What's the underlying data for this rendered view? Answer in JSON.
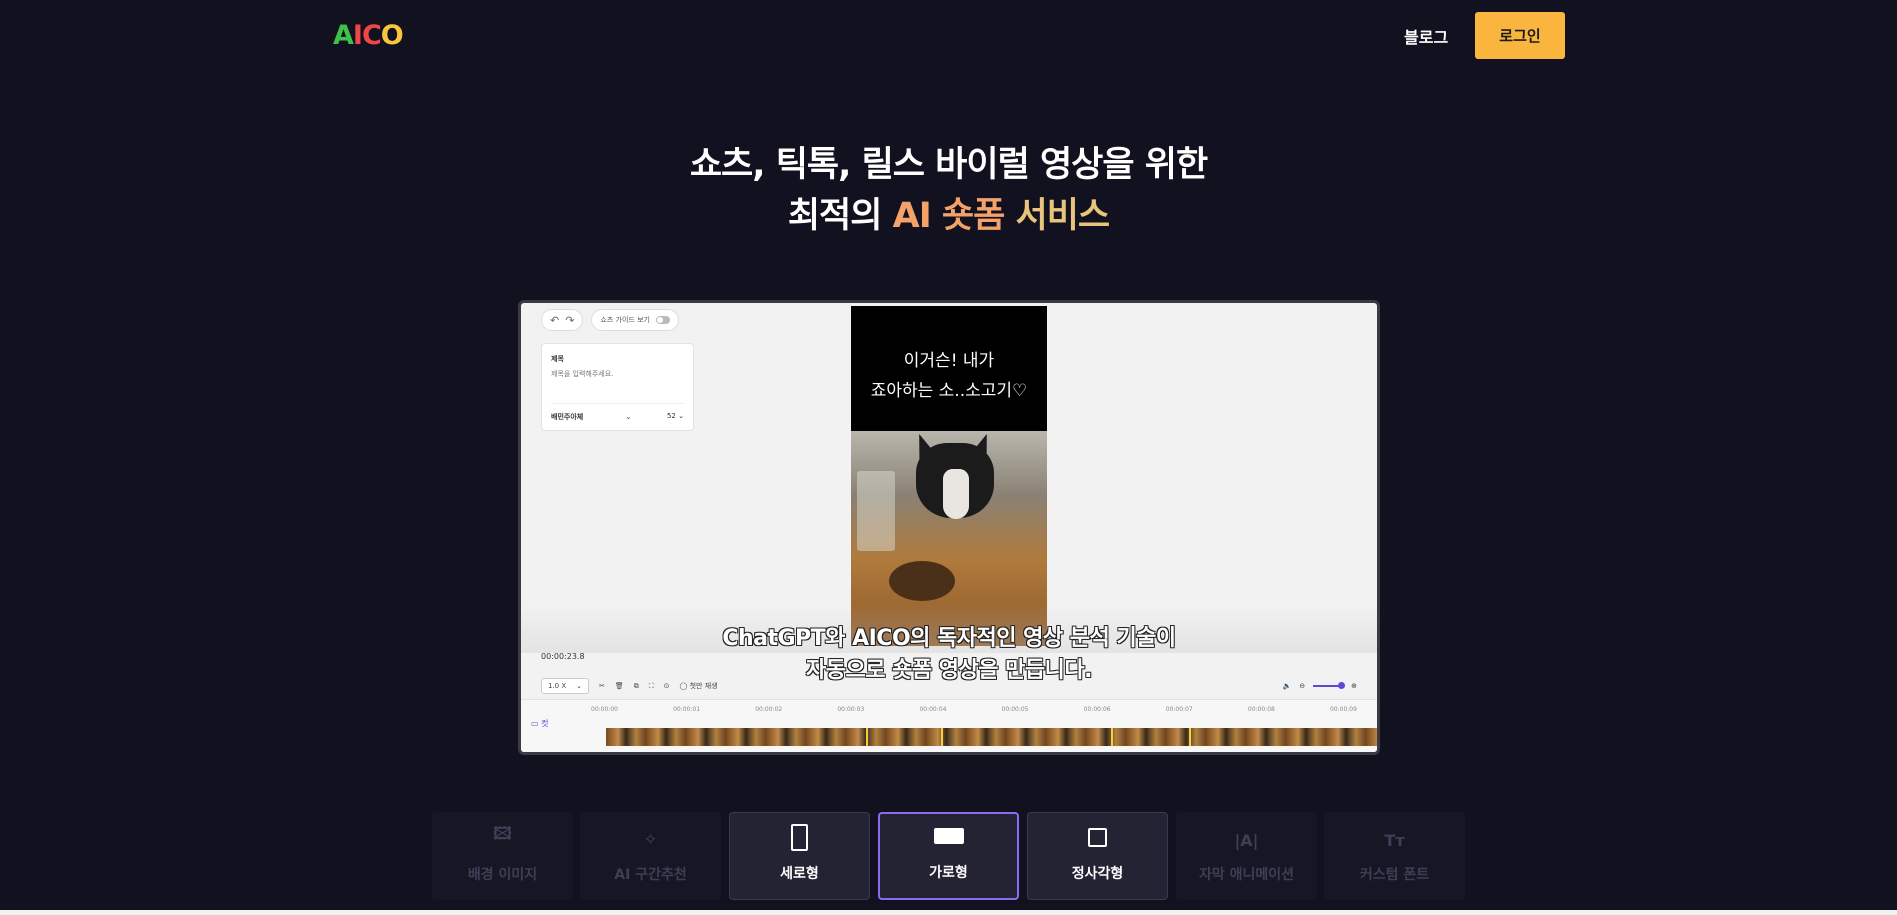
{
  "header": {
    "logo": [
      "A",
      "I",
      "C",
      "O"
    ],
    "logo_colors": [
      "#3ec04b",
      "#f04646",
      "#f04646",
      "#f9c53d"
    ],
    "blog": "블로그",
    "login": "로그인"
  },
  "hero": {
    "line1": "쇼츠, 틱톡, 릴스 바이럴 영상을 위한",
    "line2_prefix": "최적의 ",
    "line2_accent1": "AI 숏폼",
    "line2_accent2": " 서비스"
  },
  "editor": {
    "guide_toggle": "쇼츠 가이드 보기",
    "title_card": {
      "title": "제목",
      "placeholder": "제목을 입력해주세요.",
      "font": "배민주아체",
      "size": "52"
    },
    "video_caption_line1": "이거슨! 내가",
    "video_caption_line2": "죠아하는 소..소고기♡",
    "subtitle_line1": "ChatGPT와 AICO의 독자적인 영상 분석 기술이",
    "subtitle_line2": "자동으로 숏폼 영상을 만듭니다.",
    "current_time": "00:00:23.8",
    "speed": "1.0 X",
    "first_play": "첫만 재생",
    "cut": "컷",
    "ticks": [
      "00:00:00",
      "00:00:01",
      "00:00:02",
      "00:00:03",
      "00:00:04",
      "00:00:05",
      "00:00:06",
      "00:00:07",
      "00:00:08",
      "00:00:09"
    ]
  },
  "features": [
    {
      "label": "배경 이미지",
      "icon": "image-icon",
      "state": "faded"
    },
    {
      "label": "AI 구간추천",
      "icon": "sparkle-icon",
      "state": "faded"
    },
    {
      "label": "세로형",
      "icon": "portrait-icon",
      "state": "active"
    },
    {
      "label": "가로형",
      "icon": "landscape-icon",
      "state": "selected"
    },
    {
      "label": "정사각형",
      "icon": "square-icon",
      "state": "active"
    },
    {
      "label": "자막 애니메이션",
      "icon": "text-cursor-icon",
      "state": "faded"
    },
    {
      "label": "커스텀 폰트",
      "icon": "font-icon",
      "state": "faded"
    }
  ]
}
